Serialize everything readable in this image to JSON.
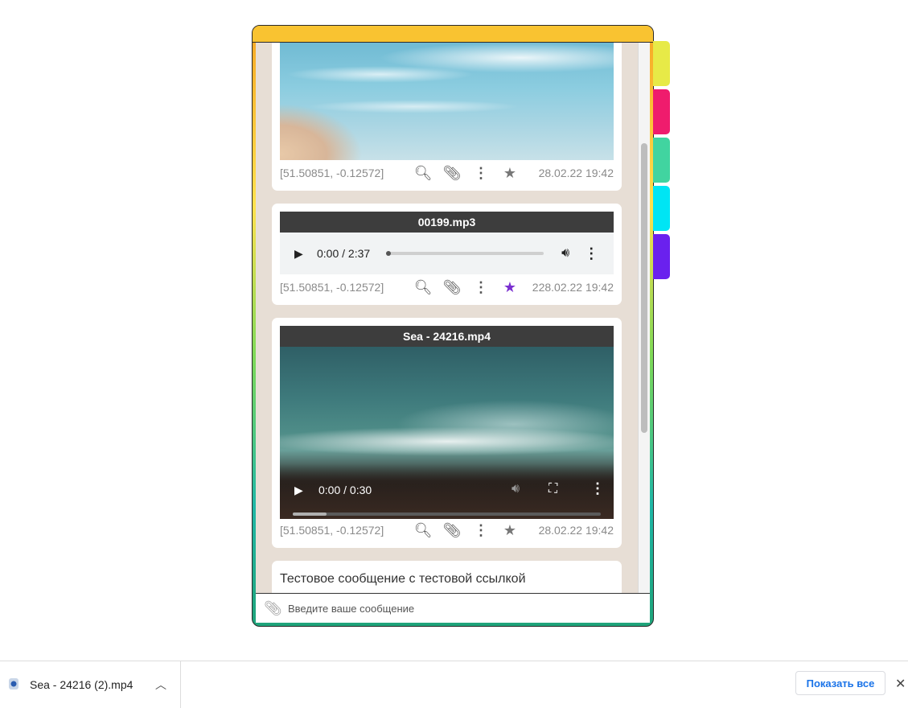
{
  "cards": [
    {
      "coords": "[51.50851, -0.12572]",
      "date": "28.02.22 19:42"
    },
    {
      "title": "00199.mp3",
      "time": "0:00 / 2:37",
      "coords": "[51.50851, -0.12572]",
      "date": "228.02.22 19:42",
      "starred": true
    },
    {
      "title": "Sea - 24216.mp4",
      "time": "0:00 / 0:30",
      "coords": "[51.50851, -0.12572]",
      "date": "28.02.22 19:42"
    },
    {
      "text": "Тестовое сообщение с тестовой ссылкой"
    }
  ],
  "composer": {
    "placeholder": "Введите ваше сообщение"
  },
  "icons": {
    "search": "magnifier-icon",
    "attach": "paperclip-icon",
    "more": "more-vertical-icon",
    "star": "star-icon",
    "play": "play-icon",
    "volume": "volume-icon",
    "fullscreen": "fullscreen-icon"
  },
  "colors": {
    "star_active": "#7a2fd0",
    "tabs": [
      "#e7ea47",
      "#ef1c6d",
      "#41d4a0",
      "#00e5f4",
      "#6a21ee"
    ]
  },
  "downloads": {
    "file_name": "Sea - 24216 (2).mp4",
    "show_all": "Показать все"
  }
}
